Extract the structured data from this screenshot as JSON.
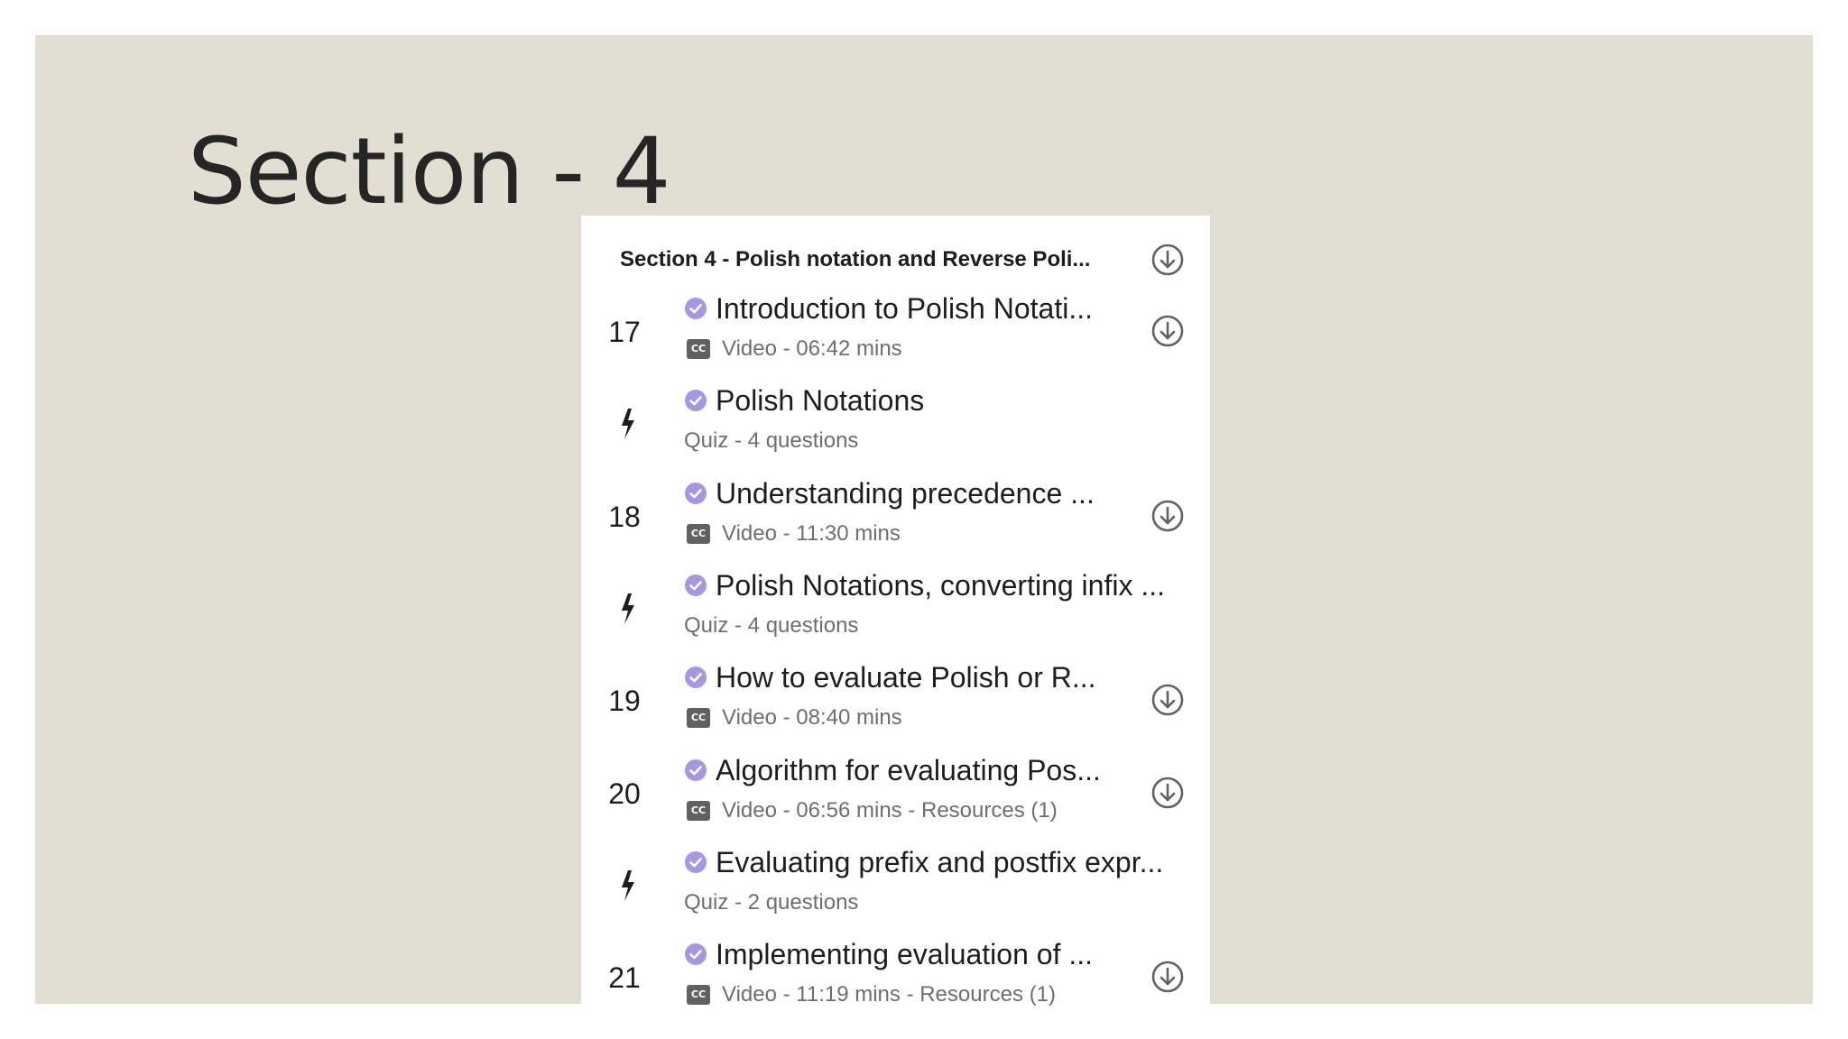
{
  "slide": {
    "title": "Section - 4",
    "background_color": "#e2dfd2"
  },
  "panel": {
    "header_title": "Section 4 - Polish notation and Reverse Poli...",
    "items": [
      {
        "kind": "video",
        "number": "17",
        "title": "Introduction to Polish Notati...",
        "meta": "Video - 06:42 mins",
        "completed": true,
        "downloadable": true
      },
      {
        "kind": "quiz",
        "title": "Polish Notations",
        "meta": "Quiz - 4 questions",
        "completed": true,
        "downloadable": false
      },
      {
        "kind": "video",
        "number": "18",
        "title": "Understanding precedence ...",
        "meta": "Video - 11:30 mins",
        "completed": true,
        "downloadable": true
      },
      {
        "kind": "quiz",
        "title": "Polish Notations, converting infix ...",
        "meta": "Quiz - 4 questions",
        "completed": true,
        "downloadable": false
      },
      {
        "kind": "video",
        "number": "19",
        "title": "How to evaluate Polish or R...",
        "meta": "Video - 08:40 mins",
        "completed": true,
        "downloadable": true
      },
      {
        "kind": "video",
        "number": "20",
        "title": "Algorithm for evaluating Pos...",
        "meta": "Video - 06:56 mins - Resources (1)",
        "completed": true,
        "downloadable": true
      },
      {
        "kind": "quiz",
        "title": "Evaluating prefix and postfix expr...",
        "meta": "Quiz - 2 questions",
        "completed": true,
        "downloadable": false
      },
      {
        "kind": "video",
        "number": "21",
        "title": "Implementing evaluation of ...",
        "meta": "Video - 11:19 mins - Resources (1)",
        "completed": true,
        "downloadable": true
      }
    ]
  },
  "icons": {
    "completed": "check-circle-icon",
    "download": "download-circle-icon",
    "quiz": "lightning-bolt-icon",
    "captions": "closed-captions-icon"
  },
  "colors": {
    "check": "#a796e0",
    "text": "#1c1d1f",
    "meta": "#6a6f73",
    "icon": "#5f6163"
  }
}
